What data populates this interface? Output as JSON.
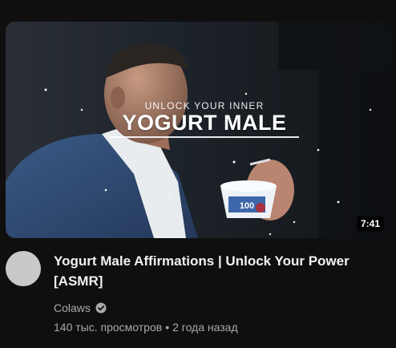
{
  "video": {
    "thumbnail": {
      "overlay_subtitle": "UNLOCK YOUR INNER",
      "overlay_title": "YOGURT MALE",
      "cup_label": "100"
    },
    "duration": "7:41",
    "title": "Yogurt Male Affirmations | Unlock Your Power [ASMR]",
    "channel": "Colaws",
    "views": "140 тыс. просмотров",
    "separator": "•",
    "published": "2 года назад"
  },
  "icons": {
    "verified": "verified-check-icon"
  },
  "colors": {
    "background": "#0f0f0f",
    "title_text": "#f1f1f1",
    "secondary_text": "#aaaaaa",
    "avatar_placeholder": "#c9c9c9"
  }
}
